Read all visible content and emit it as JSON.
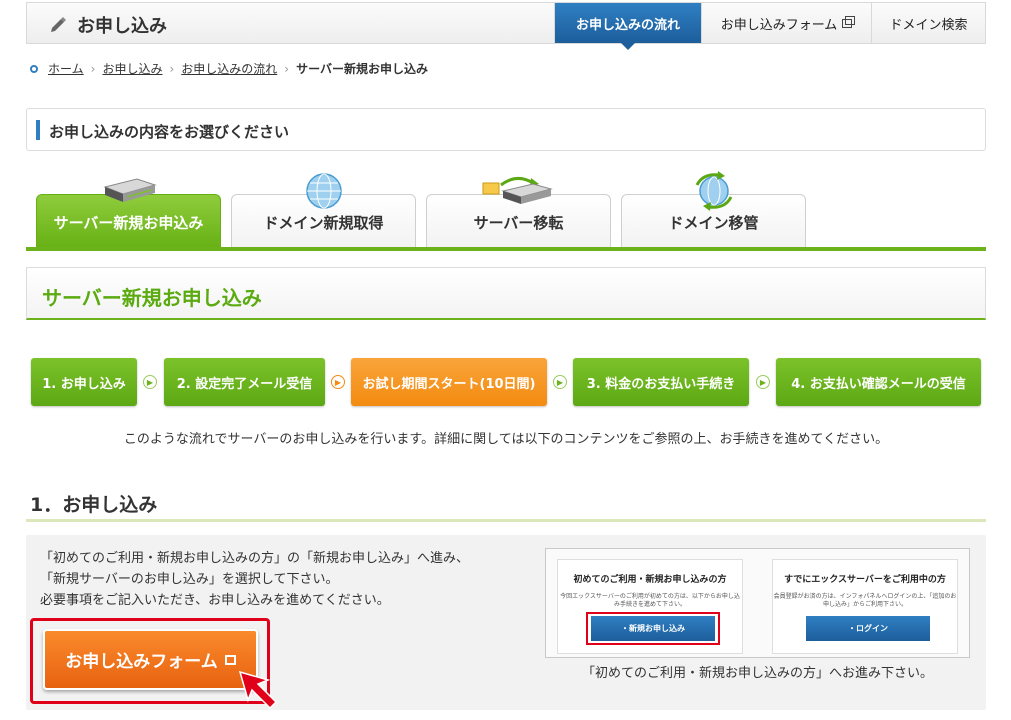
{
  "header": {
    "title": "お申し込み",
    "nav": [
      {
        "label": "お申し込みの流れ",
        "active": true
      },
      {
        "label": "お申し込みフォーム",
        "external": true
      },
      {
        "label": "ドメイン検索"
      }
    ]
  },
  "breadcrumb": {
    "items": [
      "ホーム",
      "お申し込み",
      "お申し込みの流れ"
    ],
    "current": "サーバー新規お申し込み"
  },
  "select_section": {
    "title": "お申し込みの内容をお選びください"
  },
  "tabs": [
    {
      "label": "サーバー新規お申込み",
      "icon": "server-icon",
      "active": true
    },
    {
      "label": "ドメイン新規取得",
      "icon": "globe-icon"
    },
    {
      "label": "サーバー移転",
      "icon": "server-transfer-icon"
    },
    {
      "label": "ドメイン移管",
      "icon": "globe-transfer-icon"
    }
  ],
  "section_heading": "サーバー新規お申し込み",
  "steps": [
    {
      "label": "1. お申し込み",
      "color": "#6cb31b"
    },
    {
      "label": "2. 設定完了メール受信",
      "color": "#6cb31b"
    },
    {
      "label": "お試し期間スタート(10日間)",
      "color": "#f38b10"
    },
    {
      "label": "3. 料金のお支払い手続き",
      "color": "#6cb31b"
    },
    {
      "label": "4. お支払い確認メールの受信",
      "color": "#6cb31b"
    }
  ],
  "intro": "このような流れでサーバーのお申し込みを行います。詳細に関しては以下のコンテンツをご参照の上、お手続きを進めてください。",
  "section1": {
    "title": "1．お申し込み",
    "lines": [
      "「初めてのご利用・新規お申し込みの方」の「新規お申し込み」へ進み、",
      "「新規サーバーのお申し込み」を選択して下さい。",
      "必要事項をご記入いただき、お申し込みを進めてください。"
    ],
    "form_button": "お申し込みフォーム",
    "preview": {
      "new_title": "初めてのご利用・新規お申し込みの方",
      "new_text": "今回エックスサーバーのご利用が初めての方は、以下からお申し込み手続きを進めて下さい。",
      "new_button": "・新規お申し込み",
      "existing_title": "すでにエックスサーバーをご利用中の方",
      "existing_text": "会員登録がお済の方は、インフォパネルへログインの上、「追加のお申し込み」からご利用下さい。",
      "existing_button": "・ログイン"
    },
    "caption": "「初めてのご利用・新規お申し込みの方」へお進み下さい。"
  }
}
